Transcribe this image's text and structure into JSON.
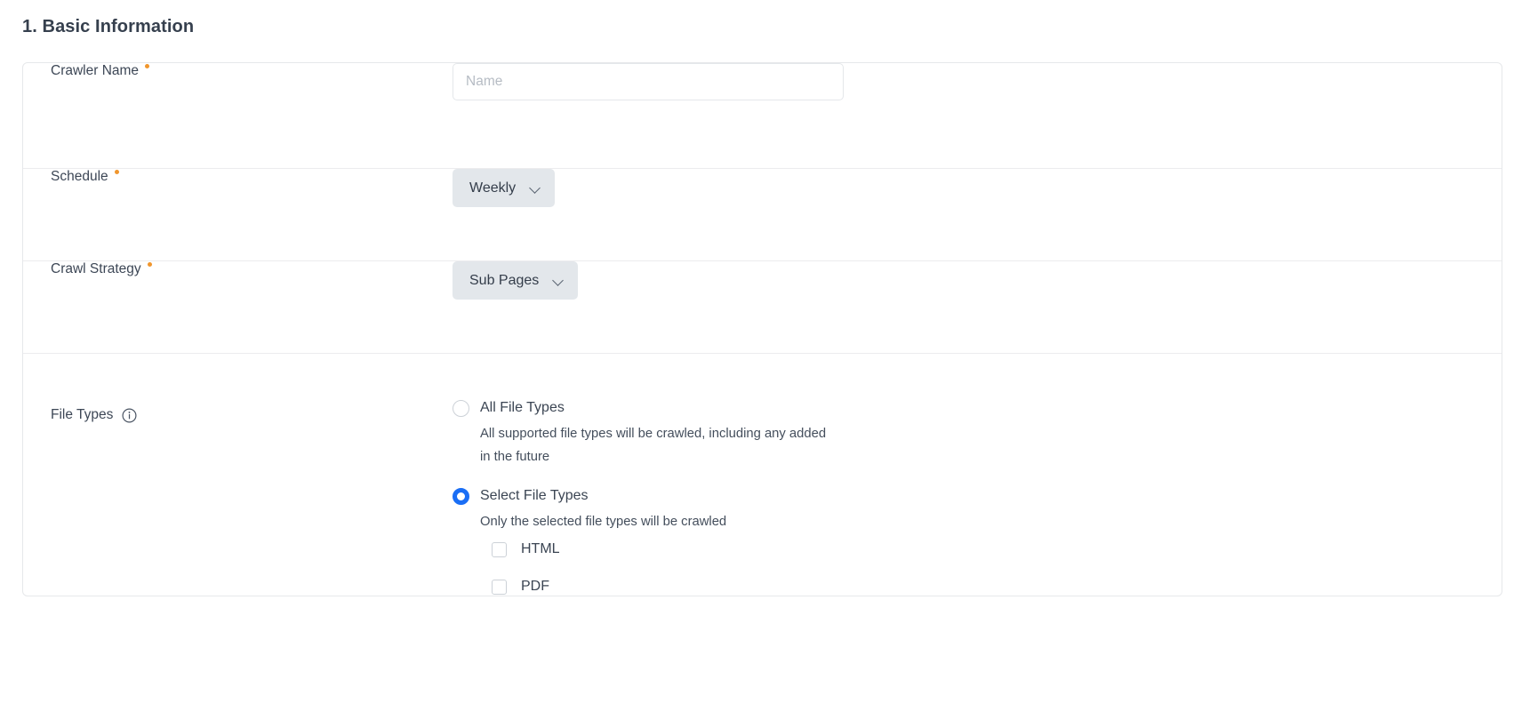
{
  "section": {
    "title": "1. Basic Information"
  },
  "fields": {
    "crawler_name": {
      "label": "Crawler Name",
      "required_marker": "•",
      "input_value": "",
      "placeholder": "Name"
    },
    "schedule": {
      "label": "Schedule",
      "required_marker": "•",
      "selected": "Weekly"
    },
    "crawl_strategy": {
      "label": "Crawl Strategy",
      "required_marker": "•",
      "selected": "Sub Pages"
    },
    "file_types": {
      "label": "File Types",
      "info_icon": "info-circle-icon",
      "options": [
        {
          "label": "All File Types",
          "description": "All supported file types will be crawled, including any added in the future",
          "selected": false
        },
        {
          "label": "Select File Types",
          "description": "Only the selected file types will be crawled",
          "selected": true
        }
      ],
      "checkboxes": [
        {
          "label": "HTML",
          "checked": false
        },
        {
          "label": "PDF",
          "checked": false
        }
      ]
    }
  },
  "colors": {
    "accent_blue": "#1a6ef5",
    "required_orange": "#f0962d",
    "text_primary": "#3b4553",
    "card_border": "#e6e8ea",
    "select_bg": "#e3e7eb"
  }
}
